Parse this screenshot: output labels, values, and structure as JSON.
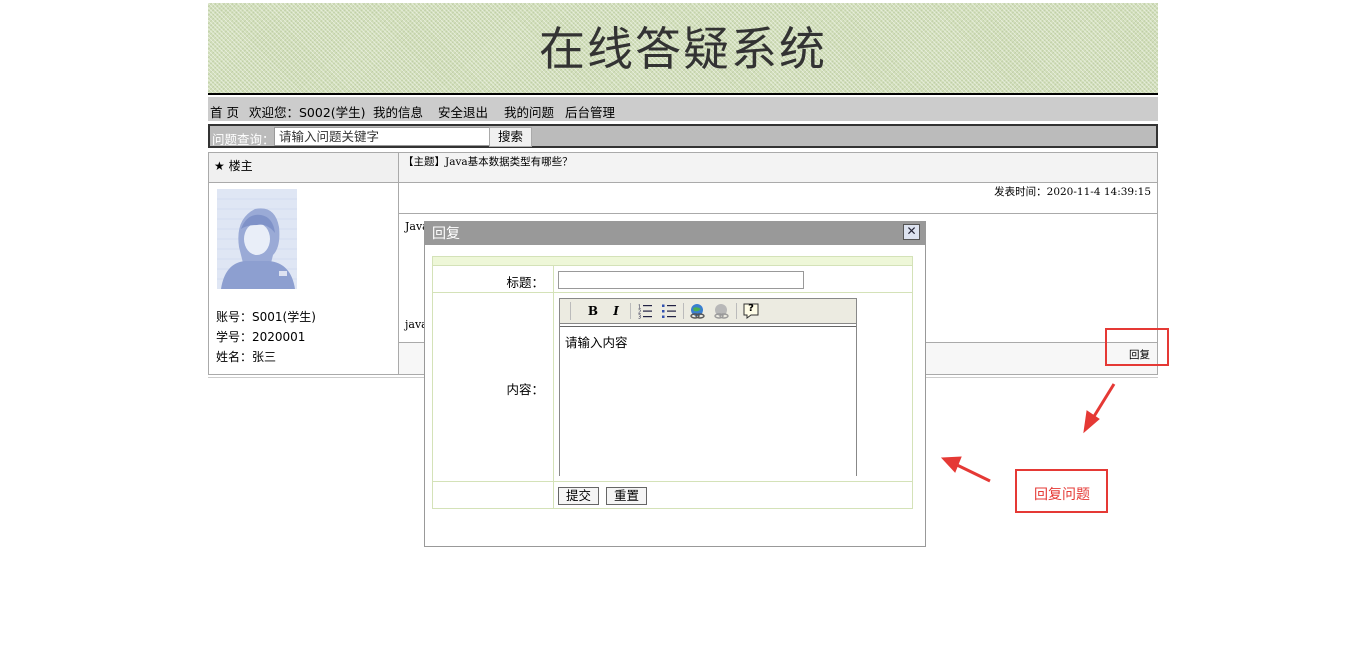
{
  "header": {
    "title": "在线答疑系统"
  },
  "nav": {
    "home": "首 页",
    "welcome": "欢迎您：S002(学生)",
    "my_info": "我的信息",
    "logout": "安全退出",
    "my_questions": "我的问题",
    "admin": "后台管理"
  },
  "search": {
    "label": "问题查询：",
    "placeholder": "请输入问题关键字",
    "button": "搜索"
  },
  "post": {
    "floor": "★ 楼主",
    "subject": "【主题】Java基本数据类型有哪些？",
    "time": "发表时间：2020-11-4 14:39:15",
    "content_line1": "Java",
    "content_line2": "java",
    "account": "账号：S001(学生)",
    "student_id": "学号：2020001",
    "name": "姓名：张三",
    "reply_link": "回复"
  },
  "dialog": {
    "title": "回复",
    "close": "✕",
    "title_label": "标题：",
    "content_label": "内容：",
    "editor_placeholder": "请输入内容",
    "toolbar": {
      "bold": "B",
      "italic": "I",
      "help": "?"
    },
    "submit": "提交",
    "reset": "重置"
  },
  "annotation": {
    "text": "回复问题",
    "color": "#e53935"
  },
  "colors": {
    "banner": "#d2dfbb",
    "nav": "#cccccc",
    "dialog_title": "#999999"
  }
}
